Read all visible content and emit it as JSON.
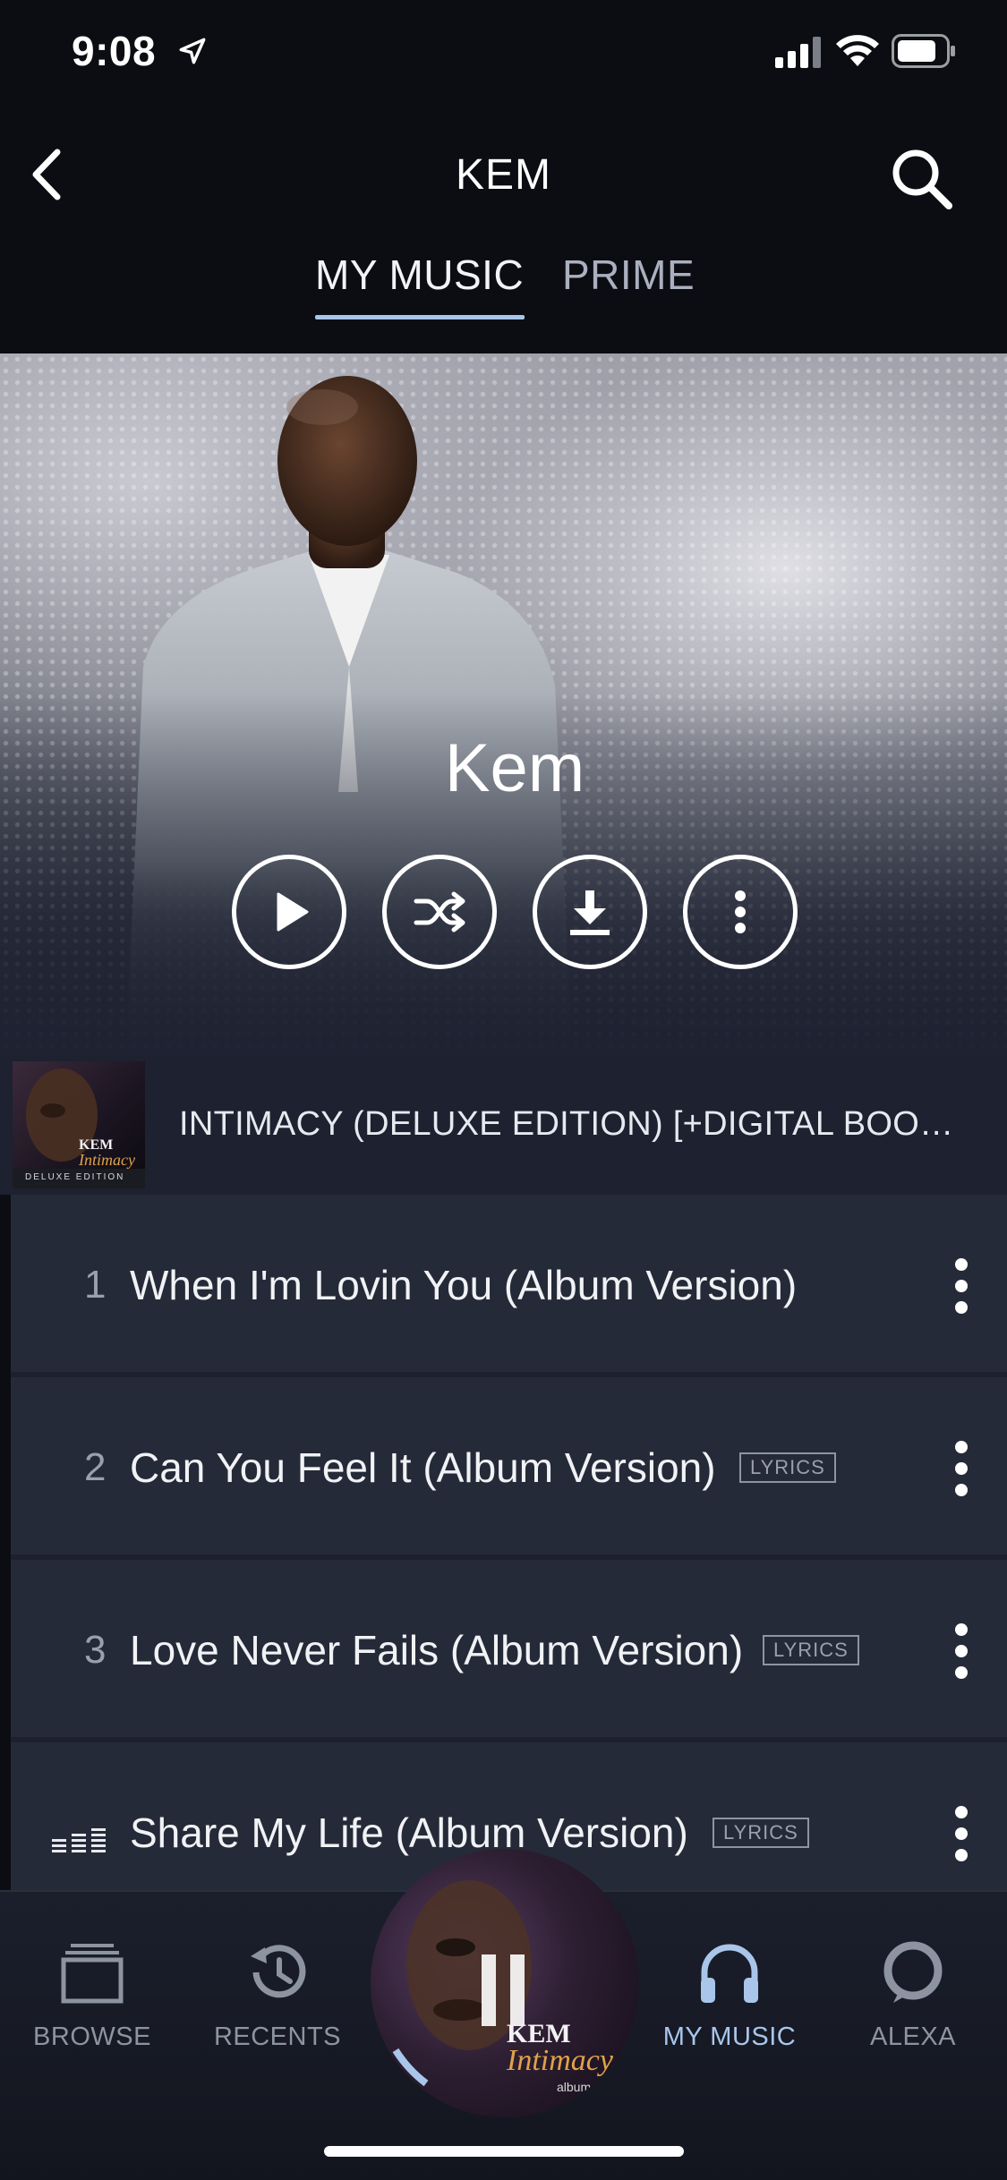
{
  "status_bar": {
    "time": "9:08",
    "icons": [
      "location-arrow-icon",
      "cellular-signal-icon",
      "wifi-icon",
      "battery-icon"
    ]
  },
  "header": {
    "title": "KEM",
    "back_icon": "chevron-left-icon",
    "search_icon": "search-icon",
    "tabs": [
      {
        "label": "MY MUSIC",
        "active": true
      },
      {
        "label": "PRIME",
        "active": false
      }
    ],
    "accent_color": "#a9c6ea"
  },
  "hero": {
    "artist_name": "Kem",
    "actions": [
      {
        "name": "play",
        "icon": "play-icon"
      },
      {
        "name": "shuffle",
        "icon": "shuffle-icon"
      },
      {
        "name": "download",
        "icon": "download-icon"
      },
      {
        "name": "more",
        "icon": "more-vertical-icon"
      }
    ]
  },
  "album": {
    "title": "INTIMACY (DELUXE EDITION) [+DIGITAL BOO…",
    "cover_text": {
      "artist": "KEM",
      "album": "Intimacy",
      "edition": "DELUXE EDITION"
    }
  },
  "tracks": [
    {
      "number": "1",
      "title": "When I'm Lovin You (Album Version)",
      "lyrics": false,
      "playing": false
    },
    {
      "number": "2",
      "title": "Can You Feel It (Album Version)",
      "lyrics": true,
      "lyrics_label": "LYRICS",
      "playing": false
    },
    {
      "number": "3",
      "title": "Love Never Fails (Album Version)",
      "lyrics": true,
      "lyrics_label": "LYRICS",
      "playing": false
    },
    {
      "number": "",
      "title": "Share My Life (Album Version)",
      "lyrics": true,
      "lyrics_label": "LYRICS",
      "playing": true
    }
  ],
  "bottom_nav": {
    "items": [
      {
        "label": "BROWSE",
        "icon": "browse-stack-icon",
        "active": false
      },
      {
        "label": "RECENTS",
        "icon": "history-clock-icon",
        "active": false
      },
      {
        "label": "MY MUSIC",
        "icon": "headphones-icon",
        "active": true
      },
      {
        "label": "ALEXA",
        "icon": "alexa-ring-icon",
        "active": false
      }
    ],
    "now_playing": {
      "state_icon": "pause-icon",
      "artist": "KEM",
      "album": "Intimacy",
      "sub": "album II"
    }
  }
}
